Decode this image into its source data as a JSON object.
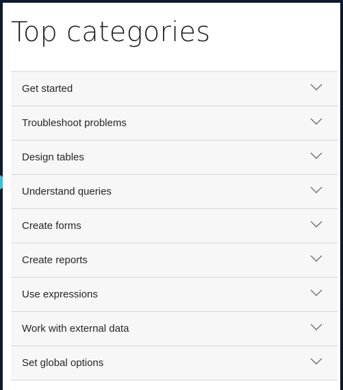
{
  "page": {
    "title": "Top categories"
  },
  "categories": [
    {
      "label": "Get started",
      "icon": "chevron-down-icon"
    },
    {
      "label": "Troubleshoot problems",
      "icon": "chevron-down-icon"
    },
    {
      "label": "Design tables",
      "icon": "chevron-down-icon"
    },
    {
      "label": "Understand queries",
      "icon": "chevron-down-icon"
    },
    {
      "label": "Create forms",
      "icon": "chevron-down-icon"
    },
    {
      "label": "Create reports",
      "icon": "chevron-down-icon"
    },
    {
      "label": "Use expressions",
      "icon": "chevron-down-icon"
    },
    {
      "label": "Work with external data",
      "icon": "chevron-down-icon"
    },
    {
      "label": "Set global options",
      "icon": "chevron-down-icon"
    }
  ],
  "colors": {
    "background": "#0b1a2e",
    "panel": "#ffffff",
    "row": "#f7f7f7",
    "divider": "#d6d6d6",
    "marker": "#33c1e6",
    "text": "#262626"
  }
}
